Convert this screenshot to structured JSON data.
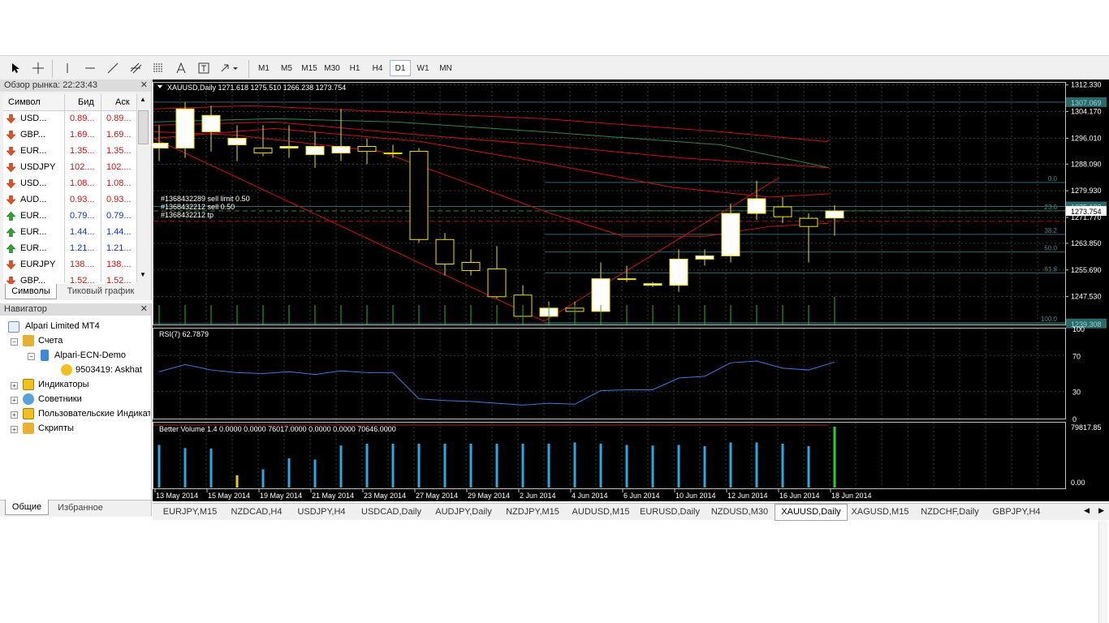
{
  "toolbar": {
    "timeframes": [
      "M1",
      "M5",
      "M15",
      "M30",
      "H1",
      "H4",
      "D1",
      "W1",
      "MN"
    ],
    "active_timeframe": "D1"
  },
  "market_watch": {
    "title": "Обзор рынка: 22:23:43",
    "columns": {
      "symbol": "Символ",
      "bid": "Бид",
      "ask": "Аск"
    },
    "rows": [
      {
        "symbol": "USD...",
        "bid": "0.89...",
        "ask": "0.89...",
        "dir": "down"
      },
      {
        "symbol": "GBP...",
        "bid": "1.69...",
        "ask": "1.69...",
        "dir": "down"
      },
      {
        "symbol": "EUR...",
        "bid": "1.35...",
        "ask": "1.35...",
        "dir": "down"
      },
      {
        "symbol": "USDJPY",
        "bid": "102....",
        "ask": "102....",
        "dir": "down"
      },
      {
        "symbol": "USD...",
        "bid": "1.08...",
        "ask": "1.08...",
        "dir": "down"
      },
      {
        "symbol": "AUD...",
        "bid": "0.93...",
        "ask": "0.93...",
        "dir": "down"
      },
      {
        "symbol": "EUR...",
        "bid": "0.79...",
        "ask": "0.79...",
        "dir": "up"
      },
      {
        "symbol": "EUR...",
        "bid": "1.44...",
        "ask": "1.44...",
        "dir": "up"
      },
      {
        "symbol": "EUR...",
        "bid": "1.21...",
        "ask": "1.21...",
        "dir": "up"
      },
      {
        "symbol": "EURJPY",
        "bid": "138....",
        "ask": "138....",
        "dir": "down"
      },
      {
        "symbol": "GBP...",
        "bid": "1.52...",
        "ask": "1.52...",
        "dir": "down"
      }
    ],
    "tabs": [
      "Символы",
      "Тиковый график"
    ]
  },
  "navigator": {
    "title": "Навигатор",
    "root": "Alpari Limited MT4",
    "accounts": "Счета",
    "server": "Alpari-ECN-Demo",
    "account": "9503419: Askhat",
    "items": [
      "Индикаторы",
      "Советники",
      "Пользовательские Индикаторы",
      "Скрипты"
    ],
    "tabs": [
      "Общие",
      "Избранное"
    ]
  },
  "chart": {
    "header": "XAUUSD,Daily  1271.618 1275.510 1266.238 1273.754",
    "price_labels": [
      "1312.330",
      "1304.170",
      "1296.010",
      "1288.090",
      "1279.930",
      "1271.770",
      "1263.850",
      "1255.690",
      "1247.530"
    ],
    "tag_labels": [
      "1307.069",
      "1275.132",
      "1273.754",
      "1239.308"
    ],
    "fib_labels": [
      "0.0",
      "23.6",
      "38.2",
      "50.0",
      "61.8",
      "100.0"
    ],
    "orders": [
      "#1368432289 sell limit 0.50",
      "#1368432212 sell 0.50",
      "#1368432212 tp"
    ],
    "rsi_label": "RSI(7) 62.7879",
    "rsi_scale": [
      "100",
      "70",
      "30",
      "0"
    ],
    "volume_label": "Better Volume 1.4 0.0000 0.0000 76017.0000 0.0000 0.0000 70646.0000",
    "volume_scale": [
      "79817.85",
      "0.00"
    ],
    "dates": [
      "13 May 2014",
      "15 May 2014",
      "19 May 2014",
      "21 May 2014",
      "23 May 2014",
      "27 May 2014",
      "29 May 2014",
      "2 Jun 2014",
      "4 Jun 2014",
      "6 Jun 2014",
      "10 Jun 2014",
      "12 Jun 2014",
      "16 Jun 2014",
      "18 Jun 2014"
    ]
  },
  "chart_data": {
    "type": "candlestick",
    "symbol": "XAUUSD",
    "timeframe": "Daily",
    "ohlc": [
      [
        1293.0,
        1300.0,
        1289.0,
        1294.5
      ],
      [
        1293.0,
        1307.0,
        1290.0,
        1305.0
      ],
      [
        1298.0,
        1306.0,
        1292.0,
        1303.0
      ],
      [
        1294.0,
        1300.0,
        1289.0,
        1296.0
      ],
      [
        1293.0,
        1300.0,
        1290.5,
        1291.5
      ],
      [
        1293.0,
        1300.0,
        1290.0,
        1293.5
      ],
      [
        1291.0,
        1298.0,
        1287.0,
        1293.5
      ],
      [
        1291.5,
        1305.0,
        1289.0,
        1293.5
      ],
      [
        1293.5,
        1296.0,
        1288.0,
        1292.0
      ],
      [
        1291.5,
        1294.0,
        1290.0,
        1291.5
      ],
      [
        1292.0,
        1293.0,
        1264.0,
        1265.0
      ],
      [
        1265.0,
        1267.0,
        1254.0,
        1257.5
      ],
      [
        1258.0,
        1262.0,
        1254.0,
        1255.5
      ],
      [
        1256.0,
        1263.0,
        1247.0,
        1247.5
      ],
      [
        1248.0,
        1251.0,
        1240.0,
        1241.5
      ],
      [
        1241.5,
        1246.0,
        1240.0,
        1244.0
      ],
      [
        1244.0,
        1246.0,
        1242.0,
        1243.0
      ],
      [
        1243.0,
        1258.0,
        1241.0,
        1253.0
      ],
      [
        1253.0,
        1257.0,
        1252.0,
        1253.0
      ],
      [
        1251.0,
        1252.0,
        1250.5,
        1251.5
      ],
      [
        1251.0,
        1262.0,
        1249.0,
        1259.0
      ],
      [
        1259.0,
        1262.0,
        1257.0,
        1260.0
      ],
      [
        1260.0,
        1276.0,
        1258.0,
        1273.0
      ],
      [
        1273.0,
        1283.0,
        1271.0,
        1277.5
      ],
      [
        1275.0,
        1278.0,
        1270.0,
        1272.0
      ],
      [
        1271.5,
        1273.0,
        1258.0,
        1269.0
      ],
      [
        1271.6,
        1275.5,
        1266.2,
        1273.754
      ]
    ],
    "rsi": [
      52,
      60,
      54,
      51,
      50,
      52,
      49,
      53,
      51,
      51,
      22,
      20,
      19,
      17,
      15,
      17,
      16,
      31,
      32,
      32,
      45,
      47,
      62,
      64,
      56,
      54,
      62.79
    ],
    "volume": [
      70,
      65,
      64,
      20,
      30,
      48,
      46,
      69,
      72,
      72,
      72,
      72,
      72,
      72,
      72,
      72,
      74,
      72,
      70,
      69,
      70,
      68,
      74,
      74,
      72,
      68,
      100
    ],
    "volume_colors": [
      "#2aa8e0",
      "#2aa8e0",
      "#2aa8e0",
      "#e8d000",
      "#2aa8e0",
      "#2aa8e0",
      "#2aa8e0",
      "#2aa8e0",
      "#2aa8e0",
      "#2aa8e0",
      "#2aa8e0",
      "#2aa8e0",
      "#2aa8e0",
      "#2aa8e0",
      "#2aa8e0",
      "#2aa8e0",
      "#2aa8e0",
      "#2aa8e0",
      "#2aa8e0",
      "#2aa8e0",
      "#2aa8e0",
      "#2aa8e0",
      "#2aa8e0",
      "#2aa8e0",
      "#2aa8e0",
      "#2aa8e0",
      "#2cd02c"
    ],
    "price_range": [
      1239.0,
      1313.0
    ]
  },
  "chart_tabs": {
    "items": [
      "EURJPY,M15",
      "NZDCAD,H4",
      "USDJPY,H4",
      "USDCAD,Daily",
      "AUDJPY,Daily",
      "NZDJPY,M15",
      "AUDUSD,M15",
      "EURUSD,Daily",
      "NZDUSD,M30",
      "XAUUSD,Daily",
      "XAGUSD,M15",
      "NZDCHF,Daily",
      "GBPJPY,H4"
    ],
    "active": "XAUUSD,Daily"
  },
  "colors": {
    "chart_bg": "#000000",
    "candle_up": "#ffffff",
    "candle_border": "#f0e000",
    "grid": "#3a3a3a",
    "ma_red": "#cc1010",
    "ma_green": "#2a8a4a",
    "fib": "#2a6a6a",
    "rsi_line": "#3a7ae0"
  }
}
